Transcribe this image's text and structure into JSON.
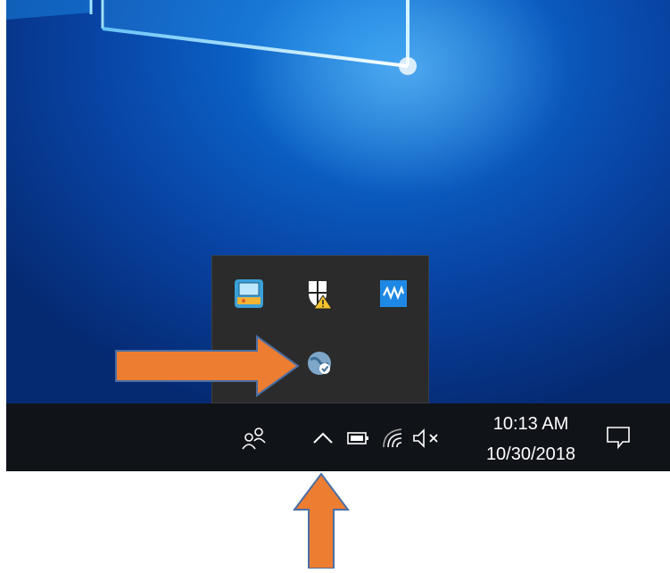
{
  "taskbar": {
    "time": "10:13 AM",
    "date": "10/30/2018",
    "icons": [
      "people-icon",
      "show-hidden-icons-chevron",
      "battery-icon",
      "wifi-icon",
      "volume-muted-icon",
      "action-center-icon"
    ]
  },
  "tray_overflow": {
    "icons": [
      "network-app-icon",
      "windows-security-warning-icon",
      "waves-app-icon",
      "globe-vpn-icon"
    ]
  },
  "annotations": {
    "arrow_color": "#ED7D31",
    "arrows": [
      "arrow-pointing-to-globe-icon",
      "arrow-pointing-to-chevron"
    ]
  },
  "colors": {
    "taskbar": "#101318",
    "flyout": "#2b2b2b",
    "desktop_blue": "#0a5cc0"
  }
}
